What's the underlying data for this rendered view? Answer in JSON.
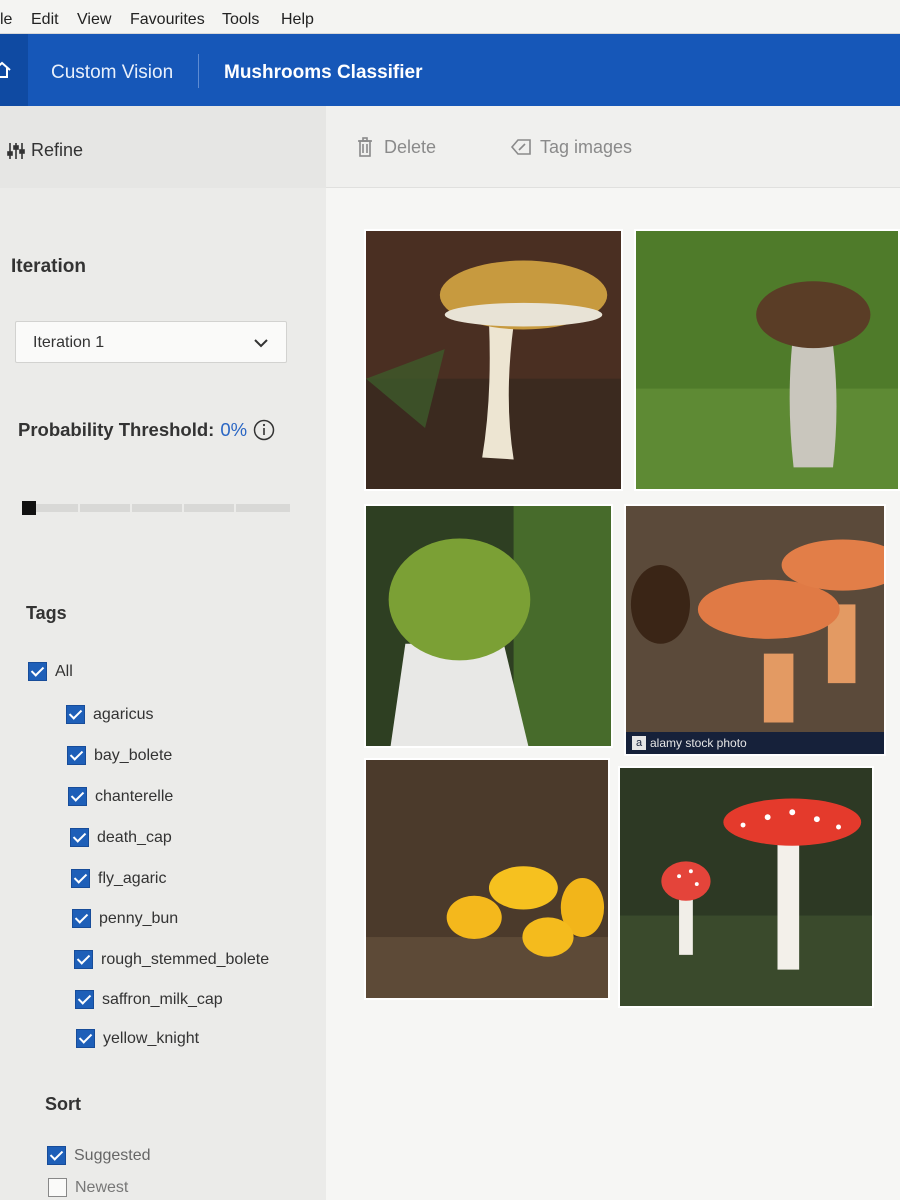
{
  "menu": [
    "le",
    "Edit",
    "View",
    "Favourites",
    "Tools",
    "Help"
  ],
  "header": {
    "brand": "Custom Vision",
    "project": "Mushrooms Classifier"
  },
  "sidebar": {
    "refine_label": "Refine",
    "iteration_heading": "Iteration",
    "iteration_selected": "Iteration 1",
    "threshold_label": "Probability Threshold:",
    "threshold_value": "0%",
    "threshold_fraction": 0,
    "tags_heading": "Tags",
    "tags": [
      {
        "label": "All",
        "checked": true
      },
      {
        "label": "agaricus",
        "checked": true
      },
      {
        "label": "bay_bolete",
        "checked": true
      },
      {
        "label": "chanterelle",
        "checked": true
      },
      {
        "label": "death_cap",
        "checked": true
      },
      {
        "label": "fly_agaric",
        "checked": true
      },
      {
        "label": "penny_bun",
        "checked": true
      },
      {
        "label": "rough_stemmed_bolete",
        "checked": true
      },
      {
        "label": "saffron_milk_cap",
        "checked": true
      },
      {
        "label": "yellow_knight",
        "checked": true
      }
    ],
    "sort_heading": "Sort",
    "sort_options": [
      {
        "label": "Suggested",
        "checked": true
      },
      {
        "label": "Newest",
        "checked": false
      }
    ]
  },
  "toolbar": {
    "delete_label": "Delete",
    "tag_label": "Tag images"
  },
  "images": [
    {
      "name": "penny-bun-photo"
    },
    {
      "name": "bay-bolete-photo"
    },
    {
      "name": "death-cap-photo"
    },
    {
      "name": "saffron-milk-cap-photo",
      "watermark": "alamy stock photo"
    },
    {
      "name": "yellow-knight-photo"
    },
    {
      "name": "fly-agaric-photo"
    }
  ],
  "colors": {
    "header": "#1657b8",
    "accent": "#2a66c4",
    "checkbox": "#1e5fb8"
  }
}
